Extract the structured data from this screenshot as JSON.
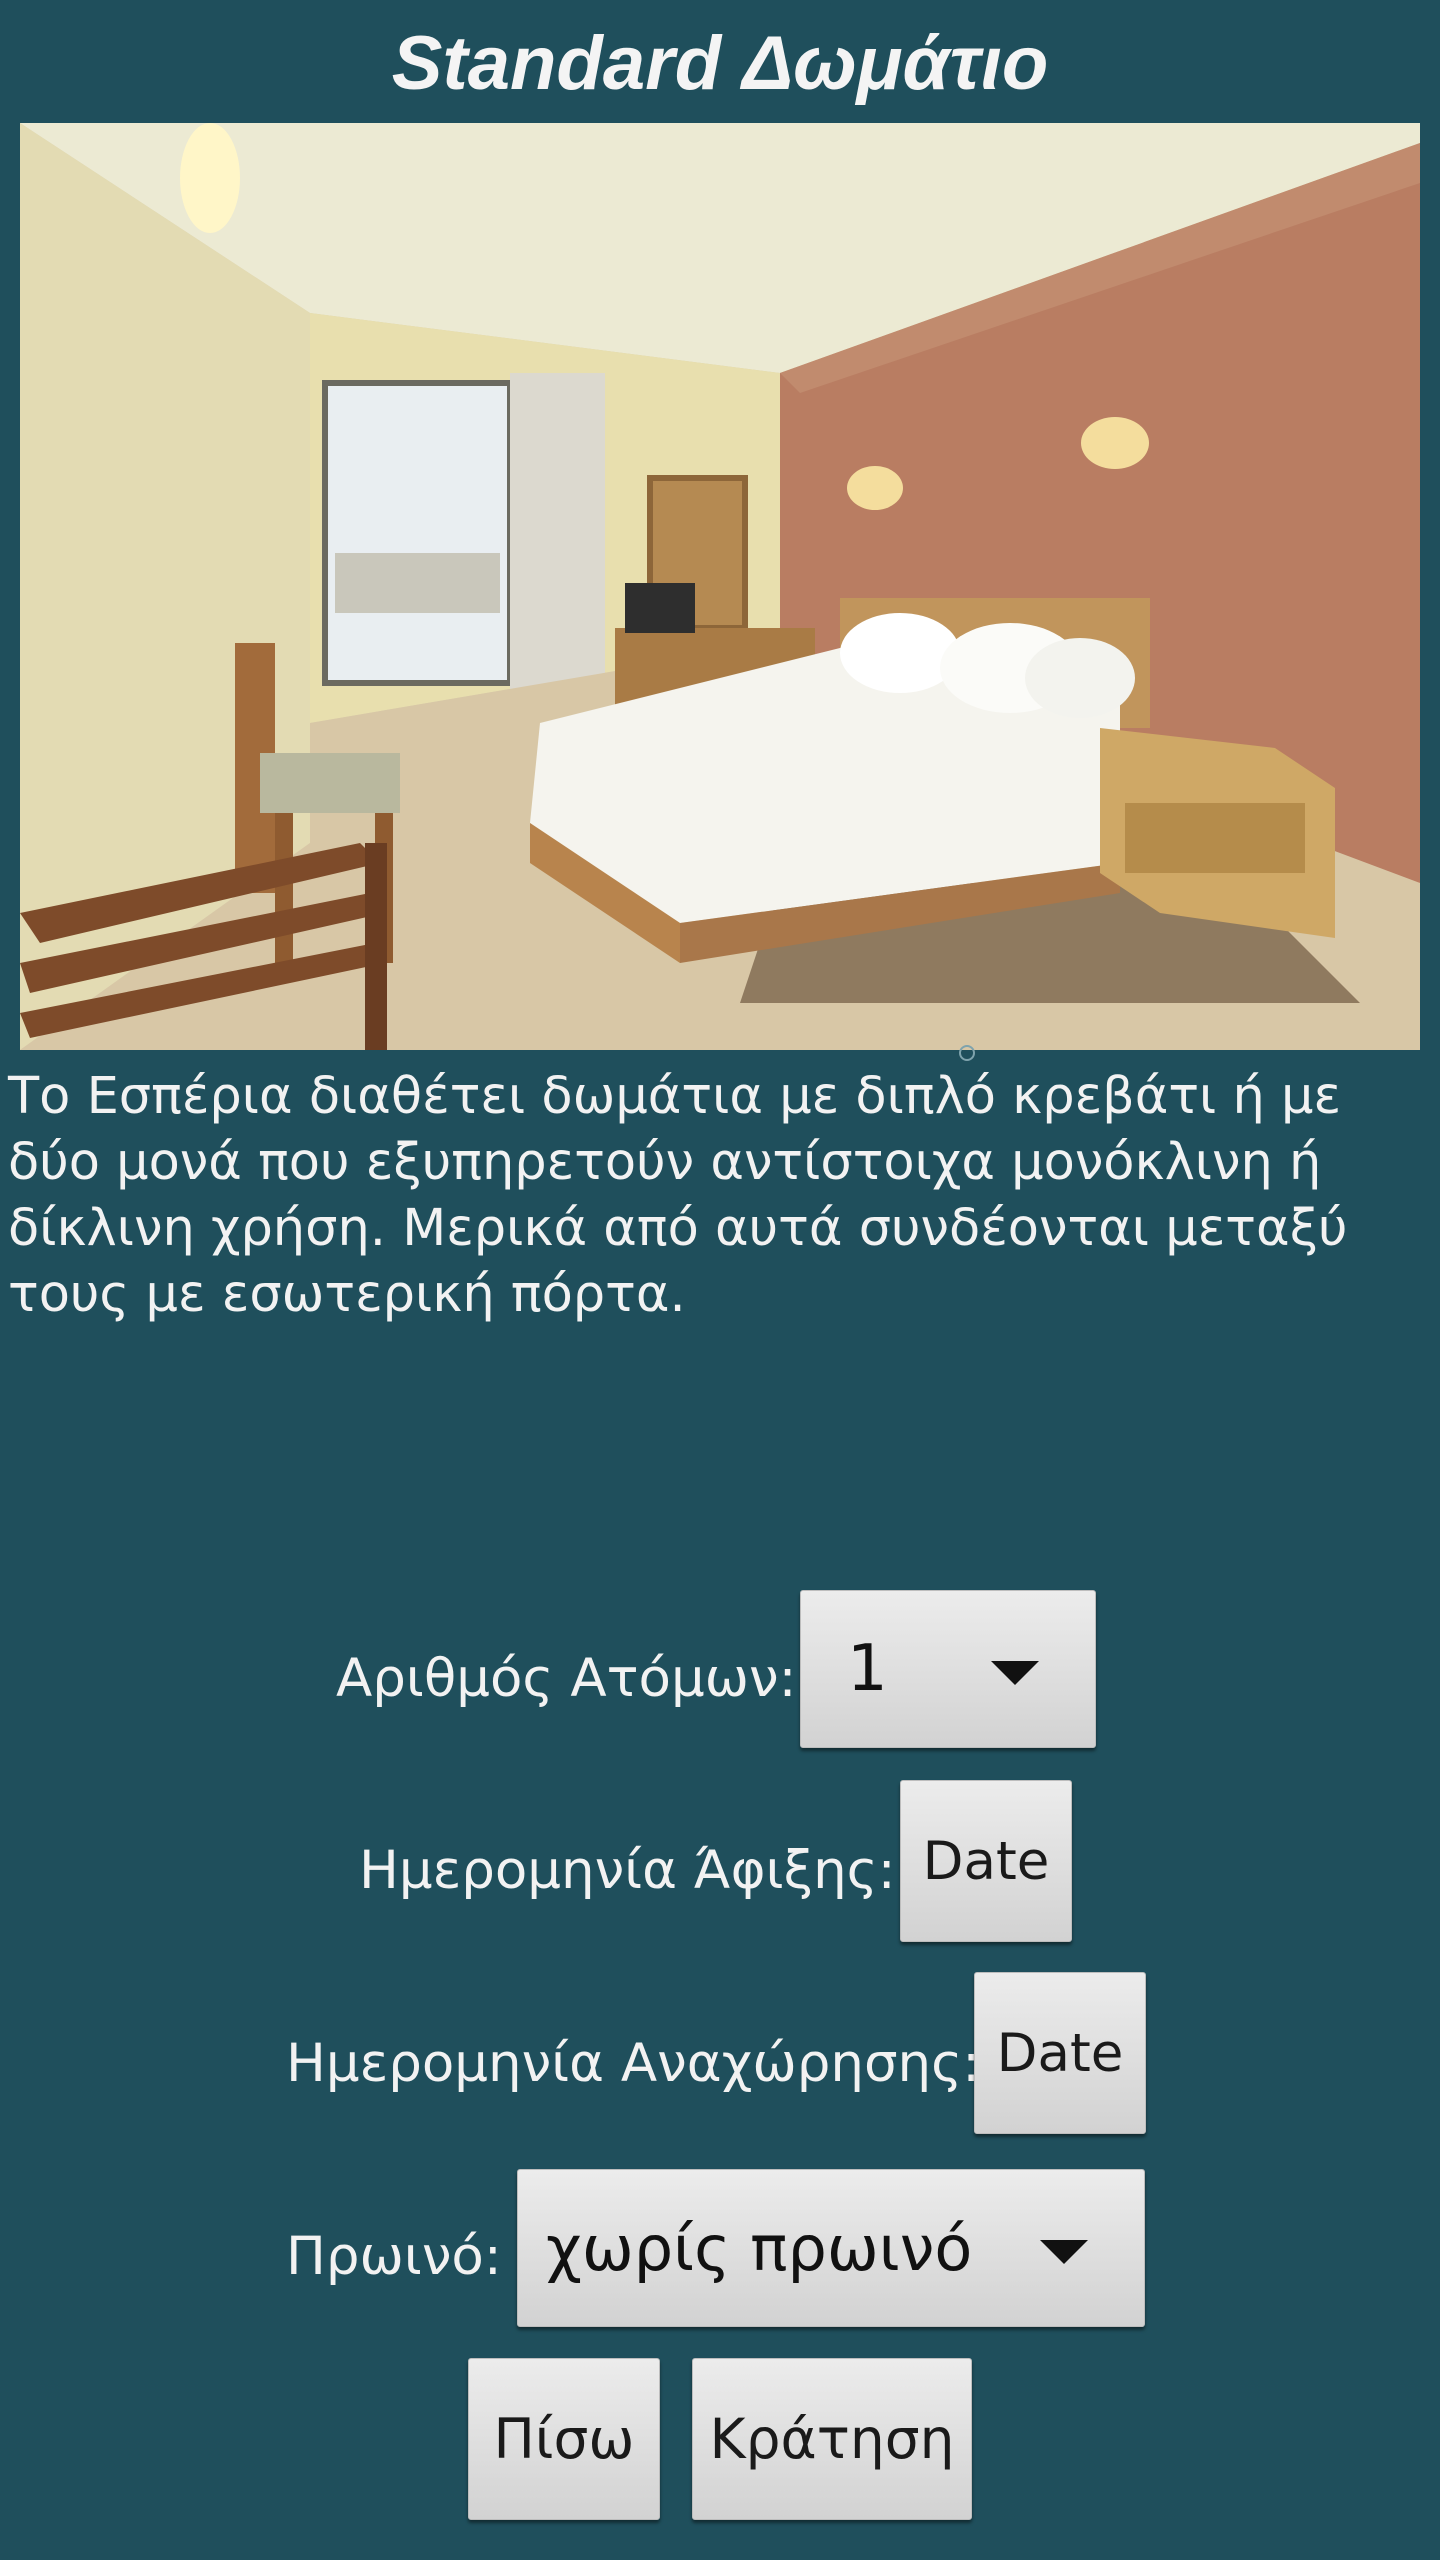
{
  "header": {
    "title": "Standard Δωμάτιο"
  },
  "room": {
    "description": "Το Εσπέρια διαθέτει δωμάτια με διπλό κρεβάτι ή με δύο μονά που εξυπηρετούν αντίστοιχα μονόκλινη ή δίκλινη χρήση. Μερικά από αυτά συνδέονται μεταξύ τους με εσωτερική πόρτα."
  },
  "form": {
    "persons_label": "Αριθμός Ατόμων:",
    "persons_value": "1",
    "arrival_label": "Ημερομηνία Άφιξης:",
    "arrival_button": "Date",
    "departure_label": "Ημερομηνία Αναχώρησης:",
    "departure_button": "Date",
    "breakfast_label": "Πρωινό:",
    "breakfast_value": "χωρίς πρωινό"
  },
  "actions": {
    "back_label": "Πίσω",
    "book_label": "Κράτηση"
  },
  "colors": {
    "background": "#1f4f5c",
    "button": "#e0e0e0",
    "text": "#ffffff"
  }
}
